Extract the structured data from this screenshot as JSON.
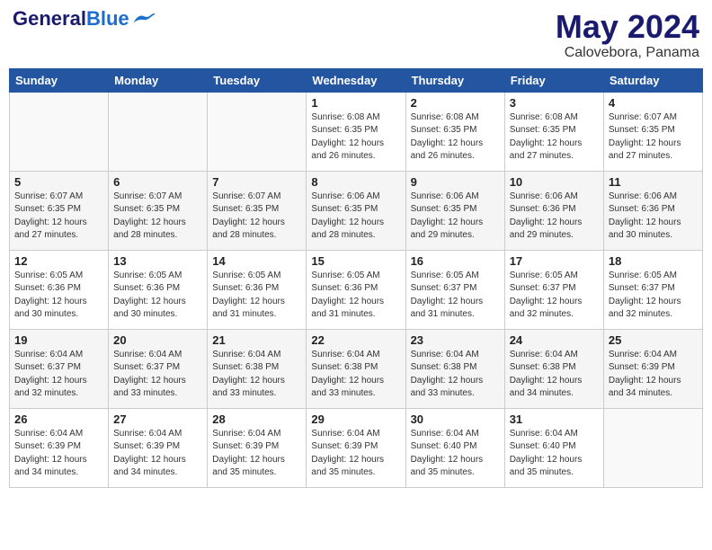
{
  "header": {
    "logo_general": "General",
    "logo_blue": "Blue",
    "month_title": "May 2024",
    "location": "Calovebora, Panama"
  },
  "weekdays": [
    "Sunday",
    "Monday",
    "Tuesday",
    "Wednesday",
    "Thursday",
    "Friday",
    "Saturday"
  ],
  "weeks": [
    [
      {
        "day": "",
        "info": ""
      },
      {
        "day": "",
        "info": ""
      },
      {
        "day": "",
        "info": ""
      },
      {
        "day": "1",
        "info": "Sunrise: 6:08 AM\nSunset: 6:35 PM\nDaylight: 12 hours\nand 26 minutes."
      },
      {
        "day": "2",
        "info": "Sunrise: 6:08 AM\nSunset: 6:35 PM\nDaylight: 12 hours\nand 26 minutes."
      },
      {
        "day": "3",
        "info": "Sunrise: 6:08 AM\nSunset: 6:35 PM\nDaylight: 12 hours\nand 27 minutes."
      },
      {
        "day": "4",
        "info": "Sunrise: 6:07 AM\nSunset: 6:35 PM\nDaylight: 12 hours\nand 27 minutes."
      }
    ],
    [
      {
        "day": "5",
        "info": "Sunrise: 6:07 AM\nSunset: 6:35 PM\nDaylight: 12 hours\nand 27 minutes."
      },
      {
        "day": "6",
        "info": "Sunrise: 6:07 AM\nSunset: 6:35 PM\nDaylight: 12 hours\nand 28 minutes."
      },
      {
        "day": "7",
        "info": "Sunrise: 6:07 AM\nSunset: 6:35 PM\nDaylight: 12 hours\nand 28 minutes."
      },
      {
        "day": "8",
        "info": "Sunrise: 6:06 AM\nSunset: 6:35 PM\nDaylight: 12 hours\nand 28 minutes."
      },
      {
        "day": "9",
        "info": "Sunrise: 6:06 AM\nSunset: 6:35 PM\nDaylight: 12 hours\nand 29 minutes."
      },
      {
        "day": "10",
        "info": "Sunrise: 6:06 AM\nSunset: 6:36 PM\nDaylight: 12 hours\nand 29 minutes."
      },
      {
        "day": "11",
        "info": "Sunrise: 6:06 AM\nSunset: 6:36 PM\nDaylight: 12 hours\nand 30 minutes."
      }
    ],
    [
      {
        "day": "12",
        "info": "Sunrise: 6:05 AM\nSunset: 6:36 PM\nDaylight: 12 hours\nand 30 minutes."
      },
      {
        "day": "13",
        "info": "Sunrise: 6:05 AM\nSunset: 6:36 PM\nDaylight: 12 hours\nand 30 minutes."
      },
      {
        "day": "14",
        "info": "Sunrise: 6:05 AM\nSunset: 6:36 PM\nDaylight: 12 hours\nand 31 minutes."
      },
      {
        "day": "15",
        "info": "Sunrise: 6:05 AM\nSunset: 6:36 PM\nDaylight: 12 hours\nand 31 minutes."
      },
      {
        "day": "16",
        "info": "Sunrise: 6:05 AM\nSunset: 6:37 PM\nDaylight: 12 hours\nand 31 minutes."
      },
      {
        "day": "17",
        "info": "Sunrise: 6:05 AM\nSunset: 6:37 PM\nDaylight: 12 hours\nand 32 minutes."
      },
      {
        "day": "18",
        "info": "Sunrise: 6:05 AM\nSunset: 6:37 PM\nDaylight: 12 hours\nand 32 minutes."
      }
    ],
    [
      {
        "day": "19",
        "info": "Sunrise: 6:04 AM\nSunset: 6:37 PM\nDaylight: 12 hours\nand 32 minutes."
      },
      {
        "day": "20",
        "info": "Sunrise: 6:04 AM\nSunset: 6:37 PM\nDaylight: 12 hours\nand 33 minutes."
      },
      {
        "day": "21",
        "info": "Sunrise: 6:04 AM\nSunset: 6:38 PM\nDaylight: 12 hours\nand 33 minutes."
      },
      {
        "day": "22",
        "info": "Sunrise: 6:04 AM\nSunset: 6:38 PM\nDaylight: 12 hours\nand 33 minutes."
      },
      {
        "day": "23",
        "info": "Sunrise: 6:04 AM\nSunset: 6:38 PM\nDaylight: 12 hours\nand 33 minutes."
      },
      {
        "day": "24",
        "info": "Sunrise: 6:04 AM\nSunset: 6:38 PM\nDaylight: 12 hours\nand 34 minutes."
      },
      {
        "day": "25",
        "info": "Sunrise: 6:04 AM\nSunset: 6:39 PM\nDaylight: 12 hours\nand 34 minutes."
      }
    ],
    [
      {
        "day": "26",
        "info": "Sunrise: 6:04 AM\nSunset: 6:39 PM\nDaylight: 12 hours\nand 34 minutes."
      },
      {
        "day": "27",
        "info": "Sunrise: 6:04 AM\nSunset: 6:39 PM\nDaylight: 12 hours\nand 34 minutes."
      },
      {
        "day": "28",
        "info": "Sunrise: 6:04 AM\nSunset: 6:39 PM\nDaylight: 12 hours\nand 35 minutes."
      },
      {
        "day": "29",
        "info": "Sunrise: 6:04 AM\nSunset: 6:39 PM\nDaylight: 12 hours\nand 35 minutes."
      },
      {
        "day": "30",
        "info": "Sunrise: 6:04 AM\nSunset: 6:40 PM\nDaylight: 12 hours\nand 35 minutes."
      },
      {
        "day": "31",
        "info": "Sunrise: 6:04 AM\nSunset: 6:40 PM\nDaylight: 12 hours\nand 35 minutes."
      },
      {
        "day": "",
        "info": ""
      }
    ]
  ]
}
